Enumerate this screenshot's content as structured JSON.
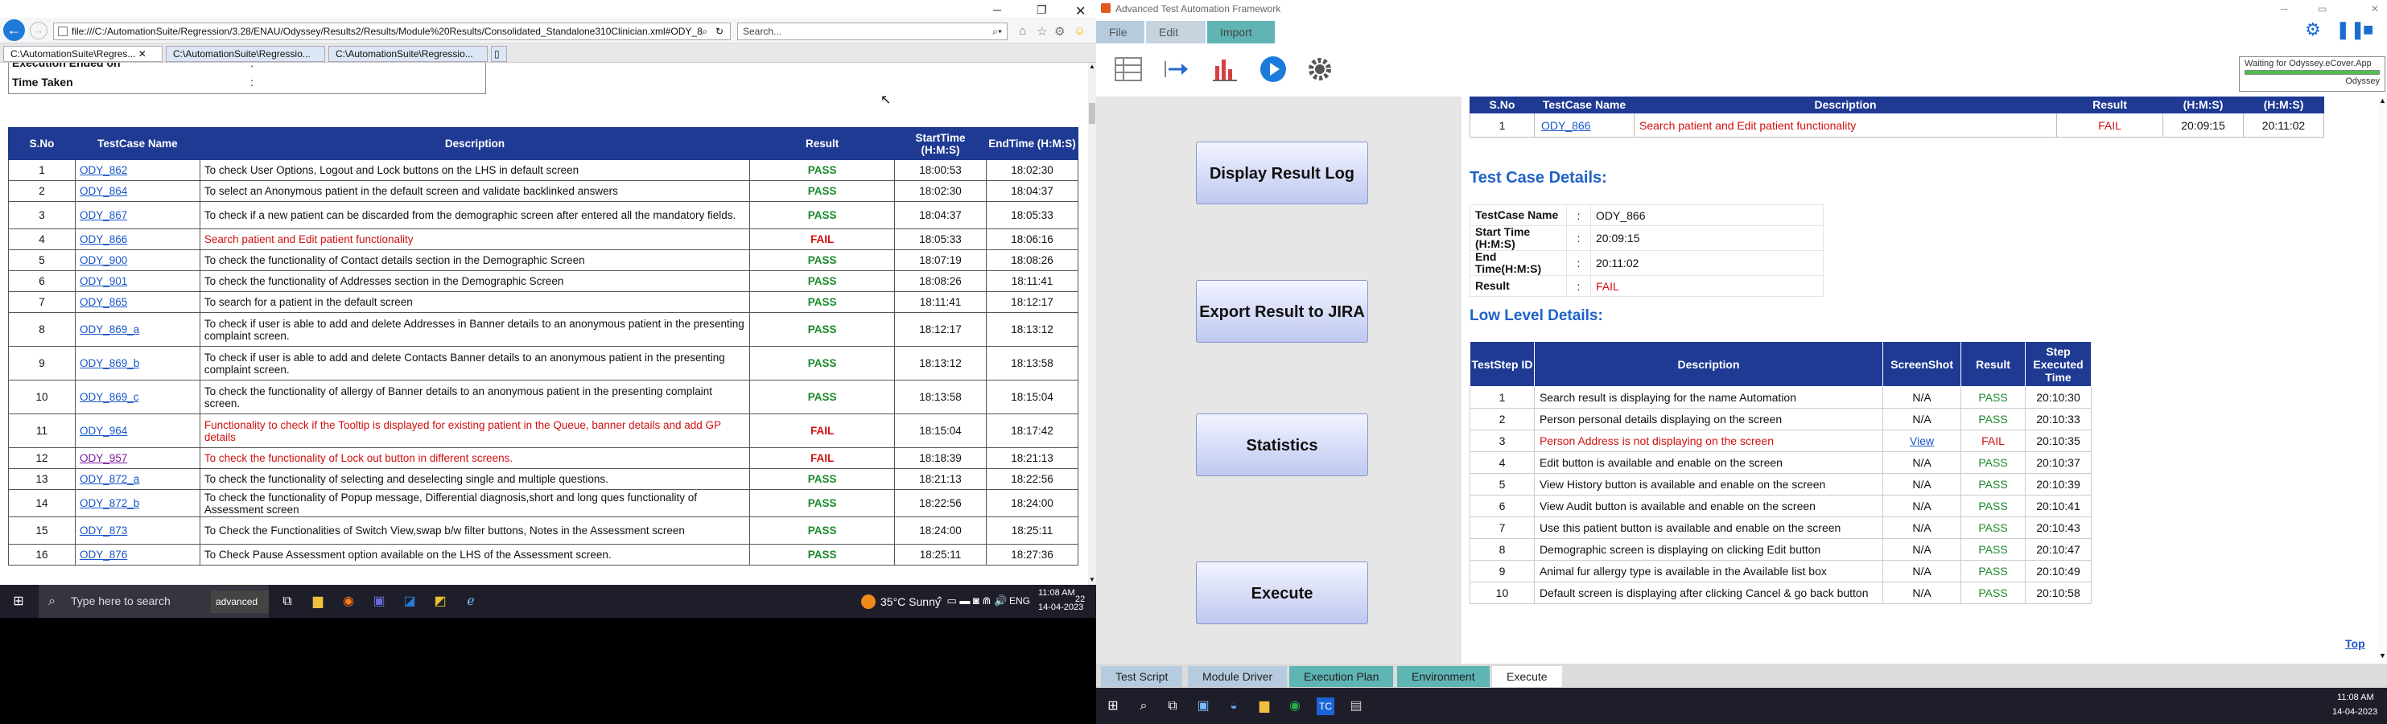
{
  "ie": {
    "address": "file:///C:/AutomationSuite/Regression/3.28/ENAU/Odyssey/Results2/Results/Module%20Results/Consolidated_Standalone310Clinician.xml#ODY_8",
    "search_placeholder": "Search...",
    "tabs": [
      "C:\\AutomationSuite\\Regres...",
      "C:\\AutomationSuite\\Regressio...",
      "C:\\AutomationSuite\\Regressio..."
    ],
    "execution_ended_label": "Execution Ended on",
    "time_taken_label": "Time Taken",
    "colon": ":"
  },
  "results_table": {
    "headers": [
      "S.No",
      "TestCase Name",
      "Description",
      "Result",
      "StartTime (H:M:S)",
      "EndTime (H:M:S)"
    ],
    "rows": [
      {
        "no": "1",
        "name": "ODY_862",
        "desc": "To check User Options, Logout and Lock buttons on the LHS in default screen",
        "result": "PASS",
        "start": "18:00:53",
        "end": "18:02:30"
      },
      {
        "no": "2",
        "name": "ODY_864",
        "desc": "To select an Anonymous patient in the default screen and validate backlinked answers",
        "result": "PASS",
        "start": "18:02:30",
        "end": "18:04:37"
      },
      {
        "no": "3",
        "name": "ODY_867",
        "desc": "To check if a new patient can be discarded from the demographic screen after entered all the mandatory fields.",
        "result": "PASS",
        "start": "18:04:37",
        "end": "18:05:33"
      },
      {
        "no": "4",
        "name": "ODY_866",
        "desc": "Search patient and Edit patient functionality",
        "result": "FAIL",
        "start": "18:05:33",
        "end": "18:06:16"
      },
      {
        "no": "5",
        "name": "ODY_900",
        "desc": "To check the functionality of Contact details section in the Demographic Screen",
        "result": "PASS",
        "start": "18:07:19",
        "end": "18:08:26"
      },
      {
        "no": "6",
        "name": "ODY_901",
        "desc": "To check the functionality of Addresses section in the Demographic Screen",
        "result": "PASS",
        "start": "18:08:26",
        "end": "18:11:41"
      },
      {
        "no": "7",
        "name": "ODY_865",
        "desc": "To search for a patient in the default screen",
        "result": "PASS",
        "start": "18:11:41",
        "end": "18:12:17"
      },
      {
        "no": "8",
        "name": "ODY_869_a",
        "desc": "To check if user is able to add and delete Addresses in Banner details to an anonymous patient in the presenting complaint screen.",
        "result": "PASS",
        "start": "18:12:17",
        "end": "18:13:12"
      },
      {
        "no": "9",
        "name": "ODY_869_b",
        "desc": "To check if user is able to add and delete Contacts Banner details to an anonymous patient in the presenting complaint screen.",
        "result": "PASS",
        "start": "18:13:12",
        "end": "18:13:58"
      },
      {
        "no": "10",
        "name": "ODY_869_c",
        "desc": "To check the functionality of allergy of Banner details to an anonymous patient in the presenting complaint screen.",
        "result": "PASS",
        "start": "18:13:58",
        "end": "18:15:04"
      },
      {
        "no": "11",
        "name": "ODY_964",
        "desc": "Functionality to check if the Tooltip is displayed for existing patient in the Queue, banner details and add GP details",
        "result": "FAIL",
        "start": "18:15:04",
        "end": "18:17:42"
      },
      {
        "no": "12",
        "name": "ODY_957",
        "desc": "To check the functionality of Lock out button in different screens.",
        "result": "FAIL",
        "start": "18:18:39",
        "end": "18:21:13"
      },
      {
        "no": "13",
        "name": "ODY_872_a",
        "desc": "To check the functionality of selecting and deselecting single and multiple questions.",
        "result": "PASS",
        "start": "18:21:13",
        "end": "18:22:56"
      },
      {
        "no": "14",
        "name": "ODY_872_b",
        "desc": "To check the functionality of Popup message, Differential diagnosis,short and long ques functionality of Assessment screen",
        "result": "PASS",
        "start": "18:22:56",
        "end": "18:24:00"
      },
      {
        "no": "15",
        "name": "ODY_873",
        "desc": "To Check the Functionalities of Switch View,swap b/w filter buttons, Notes in the Assessment screen",
        "result": "PASS",
        "start": "18:24:00",
        "end": "18:25:11"
      },
      {
        "no": "16",
        "name": "ODY_876",
        "desc": "To Check Pause Assessment option available on the LHS of the Assessment screen.",
        "result": "PASS",
        "start": "18:25:11",
        "end": "18:27:36"
      }
    ]
  },
  "taskbar_left": {
    "search_placeholder": "Type here to search",
    "app_label": "advanced",
    "weather": "35°C  Sunny",
    "lang": "ENG",
    "time": "11:08 AM",
    "date": "14-04-2023",
    "notif": "22"
  },
  "app": {
    "title": "Advanced Test Automation Framework",
    "menu": [
      "File",
      "Edit",
      "Import"
    ],
    "notify_text": "Waiting for Odyssey.eCover.App",
    "notify_sub": "Odyssey",
    "side_buttons": [
      "Display Result Log",
      "Export Result to JIRA",
      "Statistics",
      "Execute"
    ]
  },
  "detail": {
    "top_headers": [
      "S.No",
      "TestCase Name",
      "Description",
      "Result",
      "(H:M:S)",
      "(H:M:S)"
    ],
    "top_row": {
      "no": "1",
      "name": "ODY_866",
      "desc": "Search patient and Edit patient functionality",
      "result": "FAIL",
      "start": "20:09:15",
      "end": "20:11:02"
    },
    "tc_heading": "Test Case Details:",
    "tc": [
      {
        "k": "TestCase Name",
        "v": "ODY_866"
      },
      {
        "k": "Start Time (H:M:S)",
        "v": "20:09:15"
      },
      {
        "k": "End Time(H:M:S)",
        "v": "20:11:02"
      },
      {
        "k": "Result",
        "v": "FAIL"
      }
    ],
    "low_heading": "Low Level Details:",
    "low_headers": [
      "TestStep ID",
      "Description",
      "ScreenShot",
      "Result",
      "Step Executed Time"
    ],
    "low_rows": [
      {
        "id": "1",
        "desc": "Search result is displaying for the name Automation",
        "ss": "N/A",
        "result": "PASS",
        "time": "20:10:30"
      },
      {
        "id": "2",
        "desc": "Person personal details displaying on the screen",
        "ss": "N/A",
        "result": "PASS",
        "time": "20:10:33"
      },
      {
        "id": "3",
        "desc": "Person Address is not displaying on the screen",
        "ss": "View",
        "result": "FAIL",
        "time": "20:10:35"
      },
      {
        "id": "4",
        "desc": "Edit button is available and enable on the screen",
        "ss": "N/A",
        "result": "PASS",
        "time": "20:10:37"
      },
      {
        "id": "5",
        "desc": "View History button is available and enable on the screen",
        "ss": "N/A",
        "result": "PASS",
        "time": "20:10:39"
      },
      {
        "id": "6",
        "desc": "View Audit button is available and enable on the screen",
        "ss": "N/A",
        "result": "PASS",
        "time": "20:10:41"
      },
      {
        "id": "7",
        "desc": "Use this patient button is available and enable on the screen",
        "ss": "N/A",
        "result": "PASS",
        "time": "20:10:43"
      },
      {
        "id": "8",
        "desc": "Demographic screen is displaying on clicking Edit button",
        "ss": "N/A",
        "result": "PASS",
        "time": "20:10:47"
      },
      {
        "id": "9",
        "desc": "Animal fur allergy type is available in the Available list box",
        "ss": "N/A",
        "result": "PASS",
        "time": "20:10:49"
      },
      {
        "id": "10",
        "desc": "Default screen is displaying after clicking Cancel & go back button",
        "ss": "N/A",
        "result": "PASS",
        "time": "20:10:58"
      }
    ],
    "top_link": "Top"
  },
  "bottom_tabs": [
    "Test Script",
    "Module Driver",
    "Execution Plan",
    "Environment",
    "Execute"
  ],
  "taskbar_right": {
    "time": "11:08 AM",
    "date": "14-04-2023"
  },
  "colors": {
    "header_blue": "#1f3a93",
    "pass": "#1a8a2a",
    "fail": "#d01010",
    "heading": "#1f62c7"
  }
}
